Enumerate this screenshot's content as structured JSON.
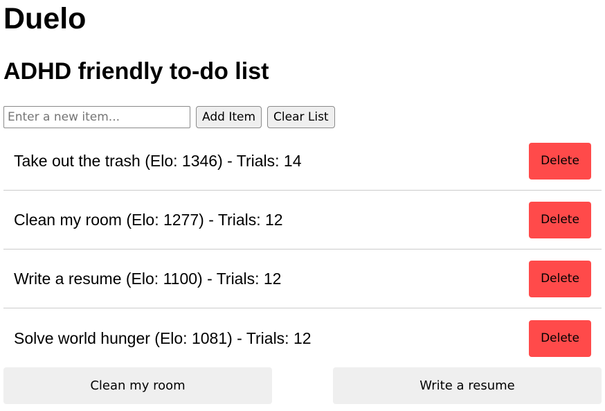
{
  "app": {
    "title": "Duelo",
    "subtitle": "ADHD friendly to-do list"
  },
  "controls": {
    "input_placeholder": "Enter a new item...",
    "input_value": "",
    "add_label": "Add Item",
    "clear_label": "Clear List"
  },
  "todos": [
    {
      "text": "Take out the trash (Elo: 1346) - Trials: 14",
      "delete_label": "Delete"
    },
    {
      "text": "Clean my room (Elo: 1277) - Trials: 12",
      "delete_label": "Delete"
    },
    {
      "text": "Write a resume (Elo: 1100) - Trials: 12",
      "delete_label": "Delete"
    },
    {
      "text": "Solve world hunger (Elo: 1081) - Trials: 12",
      "delete_label": "Delete"
    }
  ],
  "duel": {
    "left_label": "Clean my room",
    "right_label": "Write a resume"
  },
  "colors": {
    "delete_button": "#ff4a4a",
    "neutral_button": "#efefef",
    "divider": "#cccccc"
  }
}
